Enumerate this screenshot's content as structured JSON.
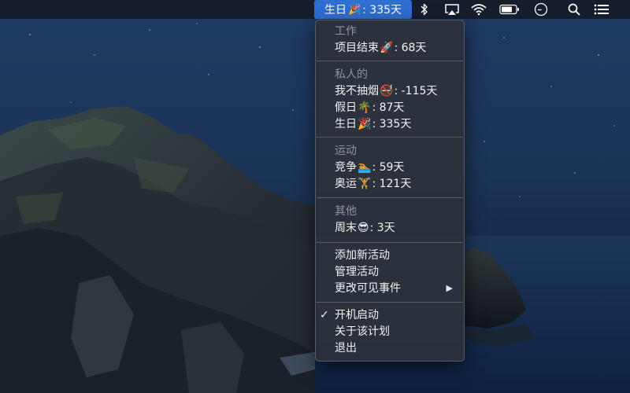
{
  "status_item": {
    "label": "生日",
    "emoji": "🎉",
    "value": ": 335天"
  },
  "menu": {
    "sections": [
      {
        "header": "工作",
        "items": [
          {
            "name": "项目结束",
            "emoji": "🚀",
            "value": ": 68天"
          }
        ]
      },
      {
        "header": "私人的",
        "items": [
          {
            "name": "我不抽烟",
            "emoji": "🚭",
            "value": ": -115天"
          },
          {
            "name": "假日",
            "emoji": "🌴",
            "value": ": 87天"
          },
          {
            "name": "生日",
            "emoji": "🎉",
            "value": ": 335天"
          }
        ]
      },
      {
        "header": "运动",
        "items": [
          {
            "name": "竞争",
            "emoji": "🏊",
            "value": ": 59天"
          },
          {
            "name": "奥运",
            "emoji": "🏋",
            "value": ": 121天"
          }
        ]
      },
      {
        "header": "其他",
        "items": [
          {
            "name": "周末",
            "emoji": "😎",
            "value": ": 3天"
          }
        ]
      }
    ],
    "actions": {
      "add": "添加新活动",
      "manage": "管理活动",
      "change_visible": "更改可见事件",
      "submenu_arrow": "▶"
    },
    "settings": {
      "launch_at_login": "开机启动",
      "launch_checked": "✓",
      "about": "关于该计划",
      "quit": "退出"
    }
  },
  "menubar_icons": [
    "bluetooth-icon",
    "airplay-icon",
    "wifi-icon",
    "battery-icon",
    "clock-icon",
    "spotlight-search-icon",
    "notification-center-icon"
  ],
  "colors": {
    "highlight": "#2f6fd1",
    "menu_bg": "#2e323a",
    "header_text": "#8f949c"
  }
}
